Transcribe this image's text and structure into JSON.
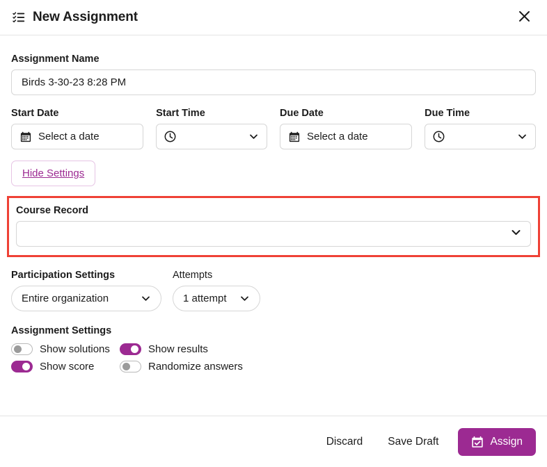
{
  "header": {
    "icon": "checklist-icon",
    "title": "New Assignment",
    "close_icon": "close-icon"
  },
  "form": {
    "assignment_name": {
      "label": "Assignment Name",
      "value": "Birds 3-30-23 8:28 PM",
      "placeholder": ""
    },
    "start_date": {
      "label": "Start Date",
      "value": "Select a date",
      "icon": "calendar-icon"
    },
    "start_time": {
      "label": "Start Time",
      "value": "",
      "icon": "clock-icon"
    },
    "due_date": {
      "label": "Due Date",
      "value": "Select a date",
      "icon": "calendar-icon"
    },
    "due_time": {
      "label": "Due Time",
      "value": "",
      "icon": "clock-icon"
    },
    "hide_settings": {
      "label": "Hide Settings"
    },
    "course_record": {
      "label": "Course Record",
      "value": "",
      "highlight_color": "#ef4136"
    },
    "participation": {
      "label": "Participation Settings",
      "value": "Entire organization"
    },
    "attempts": {
      "label": "Attempts",
      "value": "1 attempt"
    },
    "assignment_settings": {
      "label": "Assignment Settings",
      "toggles": [
        {
          "label": "Show solutions",
          "on": false
        },
        {
          "label": "Show results",
          "on": true
        },
        {
          "label": "Show score",
          "on": true
        },
        {
          "label": "Randomize answers",
          "on": false
        }
      ]
    }
  },
  "footer": {
    "discard_label": "Discard",
    "save_draft_label": "Save Draft",
    "assign_label": "Assign",
    "assign_icon": "calendar-check-icon",
    "accent_color": "#9c2a92"
  }
}
